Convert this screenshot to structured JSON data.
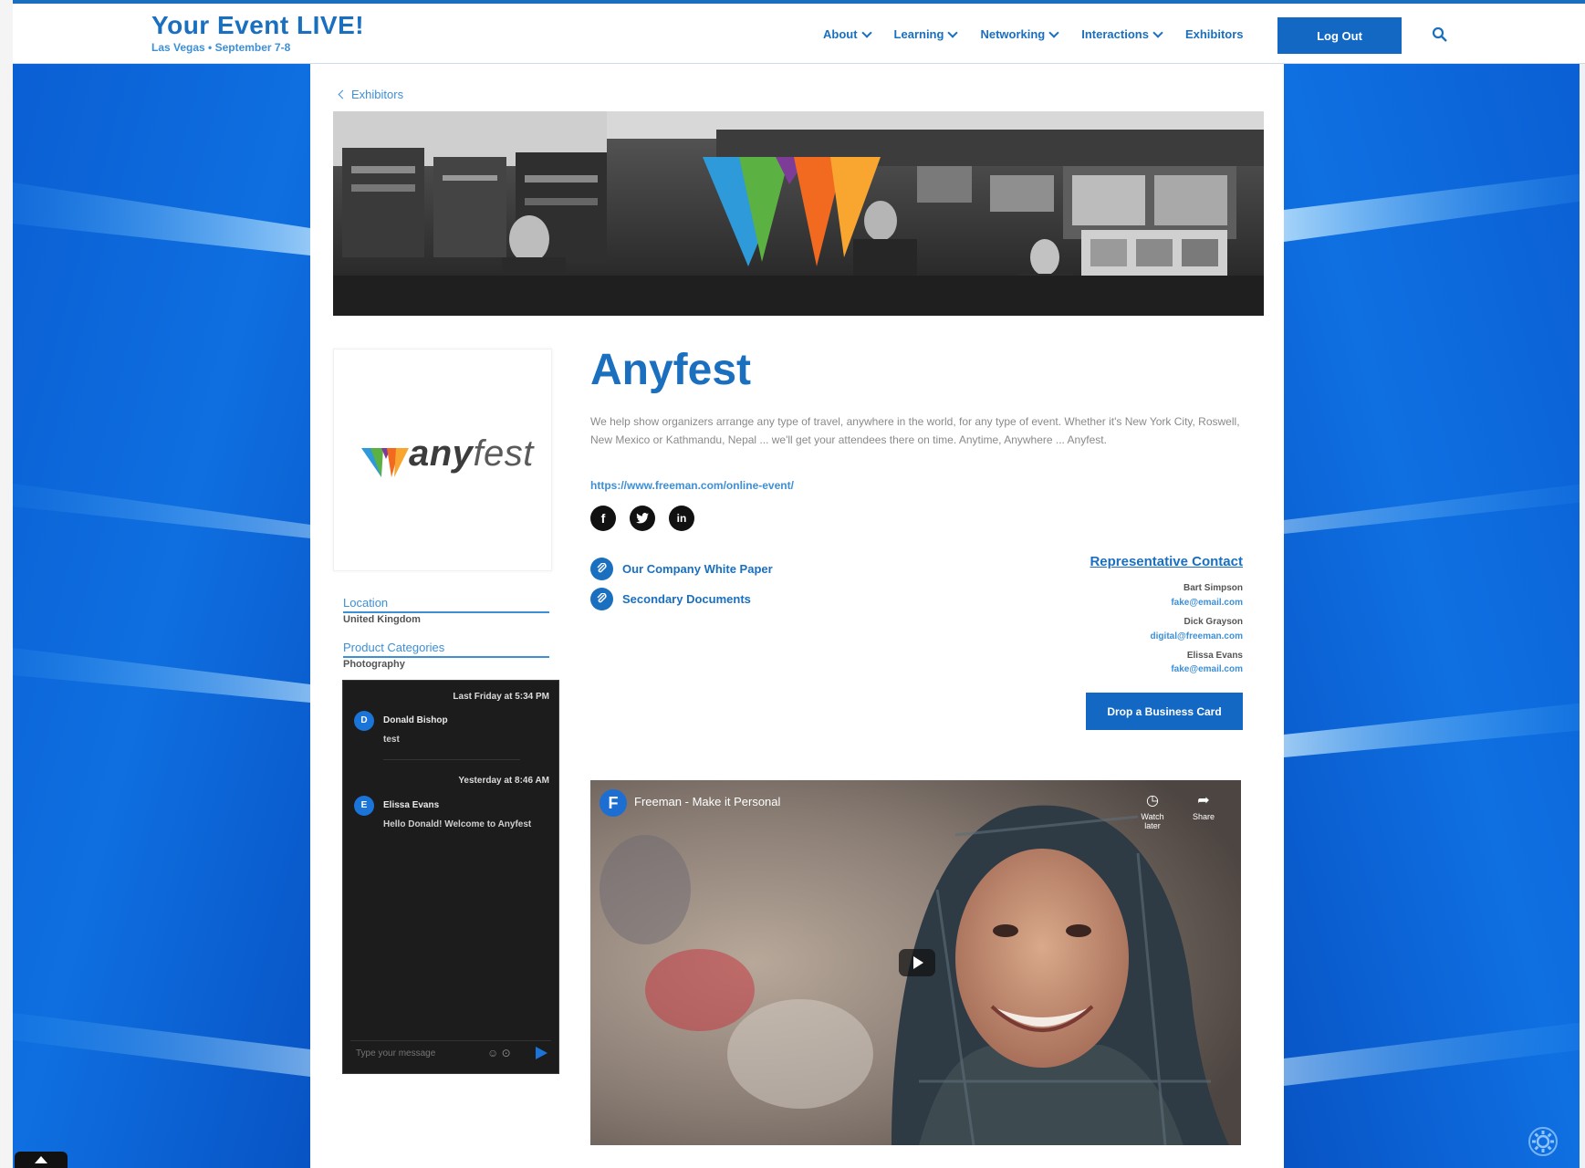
{
  "header": {
    "title": "Your Event LIVE!",
    "subtitle": "Las Vegas • September 7-8",
    "nav": [
      {
        "label": "About",
        "has_dropdown": true
      },
      {
        "label": "Learning",
        "has_dropdown": true
      },
      {
        "label": "Networking",
        "has_dropdown": true
      },
      {
        "label": "Interactions",
        "has_dropdown": true
      },
      {
        "label": "Exhibitors",
        "has_dropdown": false
      }
    ],
    "logout_label": "Log Out",
    "search_icon": "search-icon"
  },
  "breadcrumb": {
    "label": "Exhibitors"
  },
  "exhibitor": {
    "name": "Anyfest",
    "logo_text_any": "any",
    "logo_text_fest": "fest",
    "description": "We help show organizers arrange any type of travel, anywhere in the world, for any type of event. Whether it's New York City, Roswell, New Mexico or Kathmandu, Nepal ... we'll get your attendees there on time. Anytime, Anywhere ... Anyfest.",
    "website": "https://www.freeman.com/online-event/",
    "socials": [
      "facebook-icon",
      "twitter-icon",
      "linkedin-icon"
    ],
    "location_label": "Location",
    "location_value": "United Kingdom",
    "categories_label": "Product Categories",
    "categories_value": "Photography"
  },
  "documents": [
    {
      "label": "Our Company White Paper"
    },
    {
      "label": "Secondary Documents"
    }
  ],
  "representatives": {
    "title": "Representative Contact",
    "contacts": [
      {
        "name": "Bart Simpson",
        "email": "fake@email.com"
      },
      {
        "name": "Dick Grayson",
        "email": "digital@freeman.com"
      },
      {
        "name": "Elissa Evans",
        "email": "fake@email.com"
      }
    ],
    "drop_card_label": "Drop a Business Card"
  },
  "chat": {
    "messages": [
      {
        "time": "Last Friday at 5:34 PM",
        "initial": "D",
        "name": "Donald Bishop",
        "text": "test"
      },
      {
        "time": "Yesterday at 8:46 AM",
        "initial": "E",
        "name": "Elissa Evans",
        "text": "Hello Donald! Welcome to Anyfest"
      }
    ],
    "input_placeholder": "Type your message"
  },
  "video": {
    "channel_initial": "F",
    "title": "Freeman - Make it Personal",
    "watch_later_label": "Watch later",
    "share_label": "Share"
  },
  "colors": {
    "brand_blue": "#1a6fbf",
    "button_blue": "#1268c3",
    "logo_blue": "#2e9ad9",
    "logo_green": "#5cb143",
    "logo_purple": "#7d3c98",
    "logo_orange": "#f26a1f",
    "logo_yellow": "#f9a630"
  }
}
